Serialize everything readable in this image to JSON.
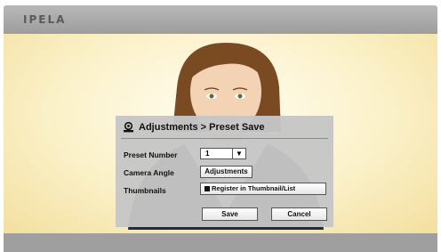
{
  "header": {
    "brand": "IPELA"
  },
  "dialog": {
    "title": "Adjustments > Preset Save",
    "title_icon": "camera-icon",
    "preset_number_label": "Preset Number",
    "preset_number_value": "1",
    "camera_angle_label": "Camera Angle",
    "adjustments_button": "Adjustments",
    "thumbnails_label": "Thumbnails",
    "register_checkbox_label": "Register in Thumbnail/List",
    "register_checked": true,
    "save_button": "Save",
    "cancel_button": "Cancel"
  },
  "colors": {
    "bar": "#9f9f9f",
    "background": "#fbf1c8",
    "dialog": "#c6c6c6"
  }
}
